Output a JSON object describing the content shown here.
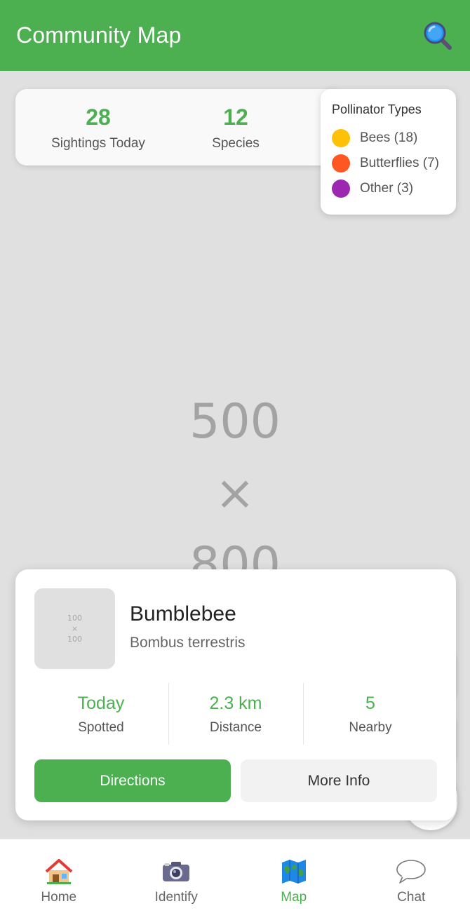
{
  "header": {
    "title": "Community Map",
    "search_icon": "magnifying-glass-icon"
  },
  "map": {
    "placeholder_lines": [
      "500",
      "×",
      "800"
    ]
  },
  "stats": [
    {
      "value": "28",
      "label": "Sightings Today"
    },
    {
      "value": "12",
      "label": "Species"
    }
  ],
  "legend": {
    "title": "Pollinator Types",
    "items": [
      {
        "label": "Bees (18)",
        "color": "#ffc107"
      },
      {
        "label": "Butterflies (7)",
        "color": "#ff5722"
      },
      {
        "label": "Other (3)",
        "color": "#9c27b0"
      }
    ]
  },
  "selected": {
    "thumbnail_lines": [
      "100",
      "×",
      "100"
    ],
    "name": "Bumblebee",
    "scientific": "Bombus terrestris",
    "metrics": [
      {
        "value": "Today",
        "label": "Spotted"
      },
      {
        "value": "2.3 km",
        "label": "Distance"
      },
      {
        "value": "5",
        "label": "Nearby"
      }
    ],
    "primary_button": "Directions",
    "secondary_button": "More Info"
  },
  "nav": {
    "items": [
      {
        "label": "Home",
        "icon": "house-icon"
      },
      {
        "label": "Identify",
        "icon": "camera-icon"
      },
      {
        "label": "Map",
        "icon": "map-icon"
      },
      {
        "label": "Chat",
        "icon": "chat-bubble-icon"
      }
    ],
    "active_index": 2
  },
  "colors": {
    "primary": "#4caf50",
    "background": "#e0e0e0"
  }
}
